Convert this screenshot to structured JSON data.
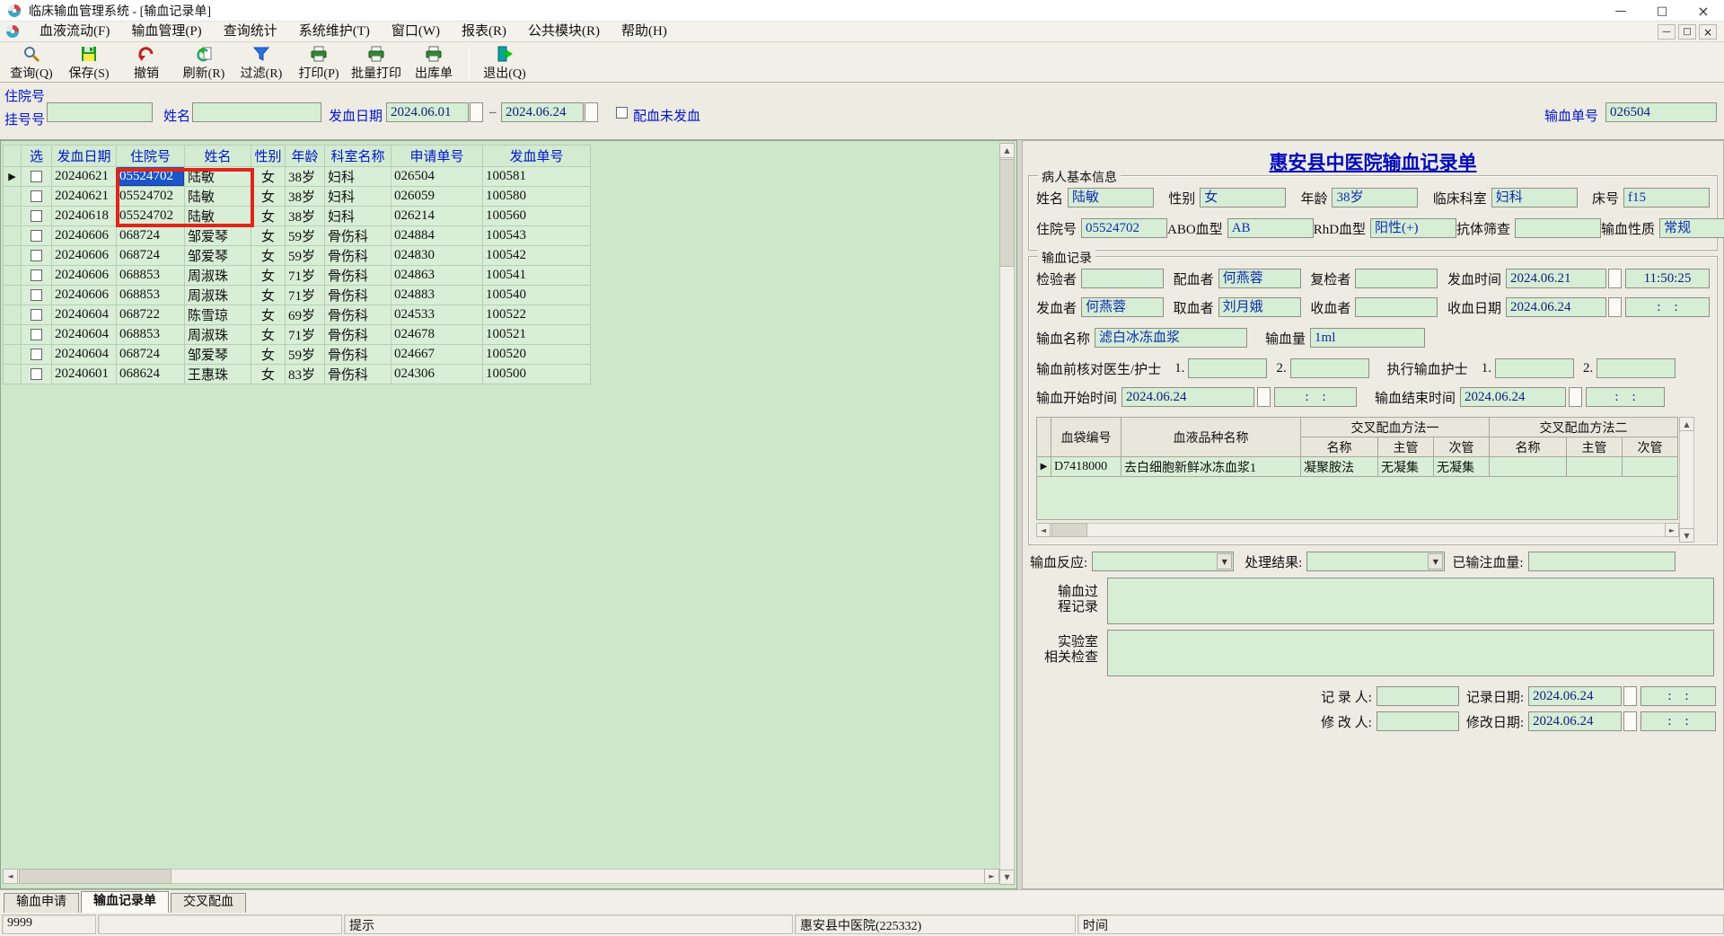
{
  "titlebar": {
    "title": "临床输血管理系统 - [输血记录单]",
    "controls": {
      "minimize": "—",
      "maximize": "□",
      "close": "×"
    }
  },
  "menu": {
    "items": [
      "血液流动(F)",
      "输血管理(P)",
      "查询统计",
      "系统维护(T)",
      "窗口(W)",
      "报表(R)",
      "公共模块(R)",
      "帮助(H)"
    ],
    "mdi_controls": {
      "minimize": "—",
      "restore": "□",
      "close": "×"
    }
  },
  "toolbar": {
    "buttons": [
      {
        "label": "查询(Q)",
        "icon": "search"
      },
      {
        "label": "保存(S)",
        "icon": "save"
      },
      {
        "label": "撤销",
        "icon": "undo"
      },
      {
        "label": "刷新(R)",
        "icon": "refresh"
      },
      {
        "label": "过滤(R)",
        "icon": "filter"
      },
      {
        "label": "打印(P)",
        "icon": "print"
      },
      {
        "label": "批量打印",
        "icon": "print-batch"
      },
      {
        "label": "出库单",
        "icon": "print-out"
      },
      {
        "label": "退出(Q)",
        "icon": "exit",
        "separator_before": true
      }
    ]
  },
  "filter": {
    "reg_label_line1": "住院号",
    "reg_label_line2": "挂号号",
    "reg_value": "",
    "name_label": "姓名",
    "name_value": "",
    "date_label": "发血日期",
    "date_from": "2024.06.01",
    "date_sep": "–",
    "date_to": "2024.06.24",
    "unissued_label": "配血未发血",
    "order_no_label": "输血单号",
    "order_no_value": "026504"
  },
  "grid": {
    "columns": [
      "选",
      "发血日期",
      "住院号",
      "姓名",
      "性别",
      "年龄",
      "科室名称",
      "申请单号",
      "发血单号"
    ],
    "rows": [
      {
        "date": "20240621",
        "pid": "05524702",
        "name": "陆敏",
        "sex": "女",
        "age": "38岁",
        "dept": "妇科",
        "req": "026504",
        "issue": "100581",
        "current": true,
        "selected_cell": true
      },
      {
        "date": "20240621",
        "pid": "05524702",
        "name": "陆敏",
        "sex": "女",
        "age": "38岁",
        "dept": "妇科",
        "req": "026059",
        "issue": "100580"
      },
      {
        "date": "20240618",
        "pid": "05524702",
        "name": "陆敏",
        "sex": "女",
        "age": "38岁",
        "dept": "妇科",
        "req": "026214",
        "issue": "100560"
      },
      {
        "date": "20240606",
        "pid": "068724",
        "name": "邹爱琴",
        "sex": "女",
        "age": "59岁",
        "dept": "骨伤科",
        "req": "024884",
        "issue": "100543"
      },
      {
        "date": "20240606",
        "pid": "068724",
        "name": "邹爱琴",
        "sex": "女",
        "age": "59岁",
        "dept": "骨伤科",
        "req": "024830",
        "issue": "100542"
      },
      {
        "date": "20240606",
        "pid": "068853",
        "name": "周淑珠",
        "sex": "女",
        "age": "71岁",
        "dept": "骨伤科",
        "req": "024863",
        "issue": "100541"
      },
      {
        "date": "20240606",
        "pid": "068853",
        "name": "周淑珠",
        "sex": "女",
        "age": "71岁",
        "dept": "骨伤科",
        "req": "024883",
        "issue": "100540"
      },
      {
        "date": "20240604",
        "pid": "068722",
        "name": "陈雪琼",
        "sex": "女",
        "age": "69岁",
        "dept": "骨伤科",
        "req": "024533",
        "issue": "100522"
      },
      {
        "date": "20240604",
        "pid": "068853",
        "name": "周淑珠",
        "sex": "女",
        "age": "71岁",
        "dept": "骨伤科",
        "req": "024678",
        "issue": "100521"
      },
      {
        "date": "20240604",
        "pid": "068724",
        "name": "邹爱琴",
        "sex": "女",
        "age": "59岁",
        "dept": "骨伤科",
        "req": "024667",
        "issue": "100520"
      },
      {
        "date": "20240601",
        "pid": "068624",
        "name": "王惠珠",
        "sex": "女",
        "age": "83岁",
        "dept": "骨伤科",
        "req": "024306",
        "issue": "100500"
      }
    ]
  },
  "record_form": {
    "title": "惠安县中医院输血记录单",
    "patient": {
      "group_label": "病人基本信息",
      "name": {
        "label": "姓名",
        "value": "陆敏"
      },
      "sex": {
        "label": "性别",
        "value": "女"
      },
      "age": {
        "label": "年龄",
        "value": "38岁"
      },
      "dept": {
        "label": "临床科室",
        "value": "妇科"
      },
      "bed": {
        "label": "床号",
        "value": "f15"
      },
      "inpatient_no": {
        "label": "住院号",
        "value": "05524702"
      },
      "abo": {
        "label": "ABO血型",
        "value": "AB"
      },
      "rhd": {
        "label": "RhD血型",
        "value": "阳性(+)"
      },
      "antibody": {
        "label": "抗体筛查",
        "value": ""
      },
      "nature": {
        "label": "输血性质",
        "value": "常规"
      }
    },
    "record": {
      "group_label": "输血记录",
      "checker": {
        "label": "检验者",
        "value": ""
      },
      "matcher": {
        "label": "配血者",
        "value": "何燕蓉"
      },
      "rechecker": {
        "label": "复检者",
        "value": ""
      },
      "issue_time": {
        "label": "发血时间",
        "date": "2024.06.21",
        "time": "11:50:25"
      },
      "issuer": {
        "label": "发血者",
        "value": "何燕蓉"
      },
      "taker": {
        "label": "取血者",
        "value": "刘月娥"
      },
      "receiver": {
        "label": "收血者",
        "value": ""
      },
      "receive_date": {
        "label": "收血日期",
        "date": "2024.06.24",
        "time": ":    :"
      },
      "blood_name": {
        "label": "输血名称",
        "value": "滤白冰冻血浆"
      },
      "blood_volume": {
        "label": "输血量",
        "value": "1ml"
      },
      "precheck_label": "输血前核对医生/护士",
      "exec_nurse_label": "执行输血护士",
      "num1": "1.",
      "num2": "2.",
      "start_time": {
        "label": "输血开始时间",
        "date": "2024.06.24",
        "time": ":    :"
      },
      "end_time": {
        "label": "输血结束时间",
        "date": "2024.06.24",
        "time": ":    :"
      }
    },
    "crossmatch": {
      "header": {
        "bag": "血袋编号",
        "product": "血液品种名称",
        "method1": "交叉配血方法一",
        "method2": "交叉配血方法二",
        "name": "名称",
        "primary": "主管",
        "secondary": "次管"
      },
      "rows": [
        {
          "bag": "D7418000",
          "product": "去白细胞新鲜冰冻血浆1",
          "m1_name": "凝聚胺法",
          "m1_primary": "无凝集",
          "m1_secondary": "无凝集",
          "m2_name": "",
          "m2_primary": "",
          "m2_secondary": ""
        }
      ]
    },
    "reaction_label": "输血反应:",
    "reaction_value": "",
    "result_label": "处理结果:",
    "result_value": "",
    "infused_label": "已输注血量:",
    "infused_value": "",
    "process_label_l1": "输血过",
    "process_label_l2": "程记录",
    "process_value": "",
    "lab_label_l1": "实验室",
    "lab_label_l2": "相关检查",
    "lab_value": "",
    "recorder_label": "记 录 人:",
    "recorder_value": "",
    "record_date_label": "记录日期:",
    "record_date": "2024.06.24",
    "record_time": ":    :",
    "modifier_label": "修 改 人:",
    "modifier_value": "",
    "modify_date_label": "修改日期:",
    "modify_date": "2024.06.24",
    "modify_time": ":    :"
  },
  "tabs": {
    "items": [
      "输血申请",
      "输血记录单",
      "交叉配血"
    ],
    "active_index": 1
  },
  "statusbar": {
    "cells": [
      "9999",
      "",
      "提示",
      "惠安县中医院(225332)",
      "时间"
    ]
  },
  "colors": {
    "accent_blue": "#0016c8",
    "input_green": "#d6edd6",
    "selection_blue": "#1b55c9",
    "annotation_red": "#e0251a"
  }
}
